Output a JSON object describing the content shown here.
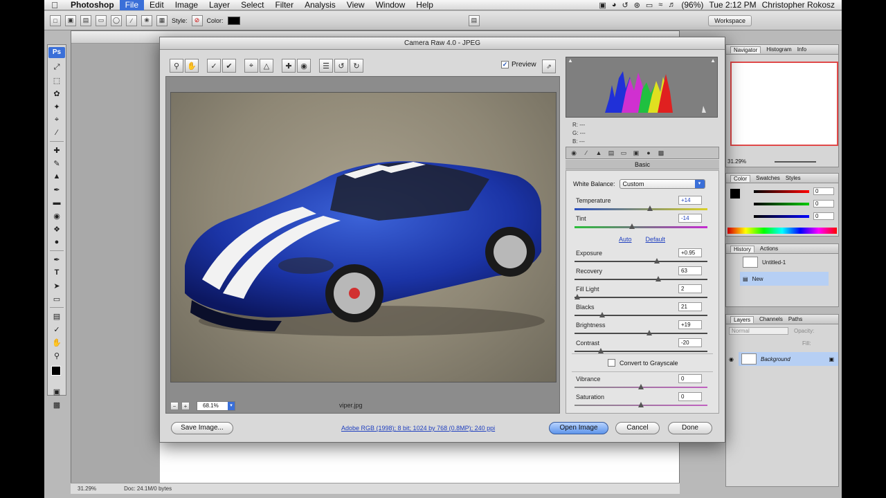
{
  "menubar": {
    "apple": "",
    "items": [
      "Photoshop",
      "File",
      "Edit",
      "Image",
      "Layer",
      "Select",
      "Filter",
      "Analysis",
      "View",
      "Window",
      "Help"
    ],
    "battery": "(96%)",
    "clock": "Tue 2:12 PM",
    "user": "Christopher Rokosz"
  },
  "options_bar": {
    "style_label": "Style:",
    "color_label": "Color:",
    "workspace_label": "Workspace"
  },
  "toolbox": {
    "logo": "Ps"
  },
  "camera_raw": {
    "title": "Camera Raw 4.0  -  JPEG",
    "preview_label": "Preview",
    "zoom_value": "68.1%",
    "filename": "viper.jpg",
    "rgb_readout": {
      "r": "R:  ---",
      "g": "G:  ---",
      "b": "B:  ---"
    },
    "panel_name": "Basic",
    "white_balance_label": "White Balance:",
    "white_balance_value": "Custom",
    "auto_link": "Auto",
    "default_link": "Default",
    "grayscale_label": "Convert to Grayscale",
    "sliders": {
      "temperature": {
        "label": "Temperature",
        "value": "+14",
        "pos": 0.57
      },
      "tint": {
        "label": "Tint",
        "value": "-14",
        "pos": 0.43
      },
      "exposure": {
        "label": "Exposure",
        "value": "+0.95",
        "pos": 0.62
      },
      "recovery": {
        "label": "Recovery",
        "value": "63",
        "pos": 0.63
      },
      "fill_light": {
        "label": "Fill Light",
        "value": "2",
        "pos": 0.02
      },
      "blacks": {
        "label": "Blacks",
        "value": "21",
        "pos": 0.21
      },
      "brightness": {
        "label": "Brightness",
        "value": "+19",
        "pos": 0.56
      },
      "contrast": {
        "label": "Contrast",
        "value": "-20",
        "pos": 0.2
      },
      "vibrance": {
        "label": "Vibrance",
        "value": "0",
        "pos": 0.5
      },
      "saturation": {
        "label": "Saturation",
        "value": "0",
        "pos": 0.5
      }
    },
    "save_button": "Save Image...",
    "workflow_text": "Adobe RGB (1998); 8 bit; 1024 by 768 (0.8MP); 240 ppi",
    "open_button": "Open Image",
    "cancel_button": "Cancel",
    "done_button": "Done"
  },
  "right_panels": {
    "navigator_tabs": [
      "Navigator",
      "Histogram",
      "Info"
    ],
    "nav_zoom": "31.29%",
    "color_tabs": [
      "Color",
      "Swatches",
      "Styles"
    ],
    "color_values": {
      "r": "0",
      "g": "0",
      "b": "0"
    },
    "history_tabs": [
      "History",
      "Actions"
    ],
    "history_items": [
      "Untitled-1",
      "New"
    ],
    "layers_tabs": [
      "Layers",
      "Channels",
      "Paths"
    ],
    "blend_mode": "Normal",
    "opacity_label": "Opacity:",
    "fill_label": "Fill:",
    "layer_name": "Background"
  },
  "status_bar": {
    "zoom": "31.29%",
    "doc": "Doc: 24.1M/0 bytes"
  }
}
